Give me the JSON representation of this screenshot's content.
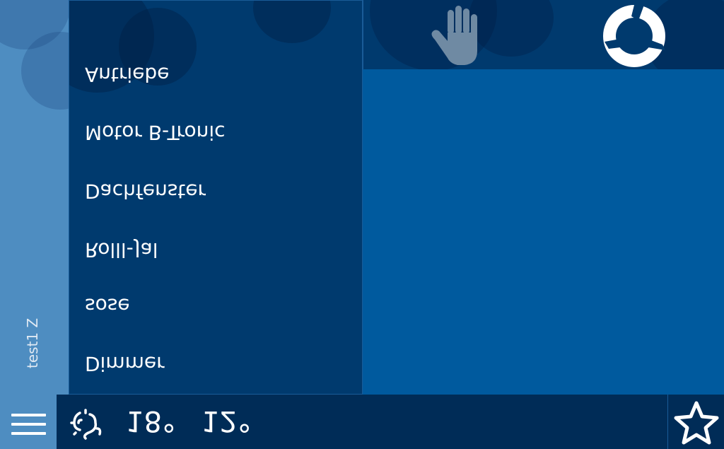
{
  "room": {
    "label": "test1 Z"
  },
  "menu": {
    "items": [
      {
        "label": "Antriebe"
      },
      {
        "label": "Motor B-Tronic"
      },
      {
        "label": "Dachfenster"
      },
      {
        "label": "Rolll-Jal"
      },
      {
        "label": "sose"
      },
      {
        "label": "Dimmer"
      }
    ]
  },
  "header": {
    "hand_icon": "hand-icon",
    "refresh_icon": "refresh-icon"
  },
  "status_bar": {
    "menu_icon": "hamburger-icon",
    "weather_icon": "weather-icon",
    "temp_outside": "18°",
    "temp_inside": "12°",
    "favorites_icon": "star-icon"
  },
  "colors": {
    "background": "#005a9e",
    "panel": "#003a6e",
    "strip": "#4e8dc1",
    "bottom_bar": "#002c57",
    "text": "#ffffff"
  }
}
